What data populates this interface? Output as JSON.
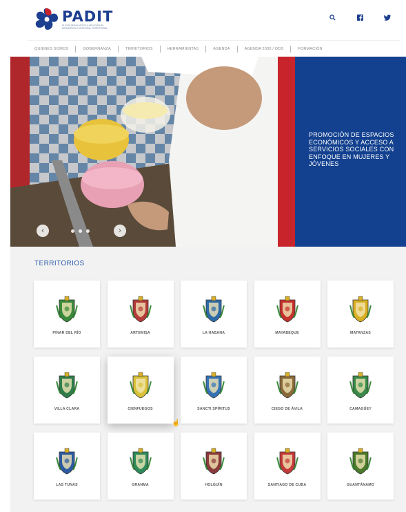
{
  "brand": {
    "name": "PADIT",
    "tagline": "PLATAFORMA ARTICULADA PARA EL DESARROLLO INTEGRAL TERRITORIAL"
  },
  "header": {
    "icons": [
      "search-icon",
      "facebook-icon",
      "twitter-icon"
    ]
  },
  "nav": {
    "items": [
      "QUIÉNES SOMOS",
      "GOBERNANZA",
      "TERRITORIOS",
      "HERRAMIENTAS",
      "AGENDA",
      "AGENDA 2030 / ODS",
      "FORMACIÓN"
    ]
  },
  "hero": {
    "headline": "PROMOCIÓN DE ESPACIOS ECONÓMICOS Y ACCESO A SERVICIOS SOCIALES CON ENFOQUE EN MUJERES Y JÓVENES",
    "slides": 3
  },
  "territories": {
    "title": "TERRITORIOS",
    "items": [
      {
        "label": "PINAR DEL RÍO",
        "color": "#3b8a3b"
      },
      {
        "label": "ARTEMISA",
        "color": "#b53a3a"
      },
      {
        "label": "LA HABANA",
        "color": "#2d6aa8"
      },
      {
        "label": "MAYABEQUE",
        "color": "#c4312d"
      },
      {
        "label": "MATANZAS",
        "color": "#d9b024"
      },
      {
        "label": "VILLA CLARA",
        "color": "#2f7d4a"
      },
      {
        "label": "CIENFUEGOS",
        "color": "#d9c23a"
      },
      {
        "label": "SANCTI SPÍRITUS",
        "color": "#3573b5"
      },
      {
        "label": "CIEGO DE ÁVILA",
        "color": "#8a6a3a"
      },
      {
        "label": "CAMAGÜEY",
        "color": "#3a8a4a"
      },
      {
        "label": "LAS TUNAS",
        "color": "#2d5aa0"
      },
      {
        "label": "GRANMA",
        "color": "#2f8a5a"
      },
      {
        "label": "HOLGUÍN",
        "color": "#8a3a3a"
      },
      {
        "label": "SANTIAGO DE CUBA",
        "color": "#c43a3a"
      },
      {
        "label": "GUANTÁNAMO",
        "color": "#4a7a2a"
      }
    ]
  },
  "colors": {
    "brand_blue": "#13418f",
    "title_blue": "#2a5aa8",
    "accent_red": "#c8242b"
  }
}
